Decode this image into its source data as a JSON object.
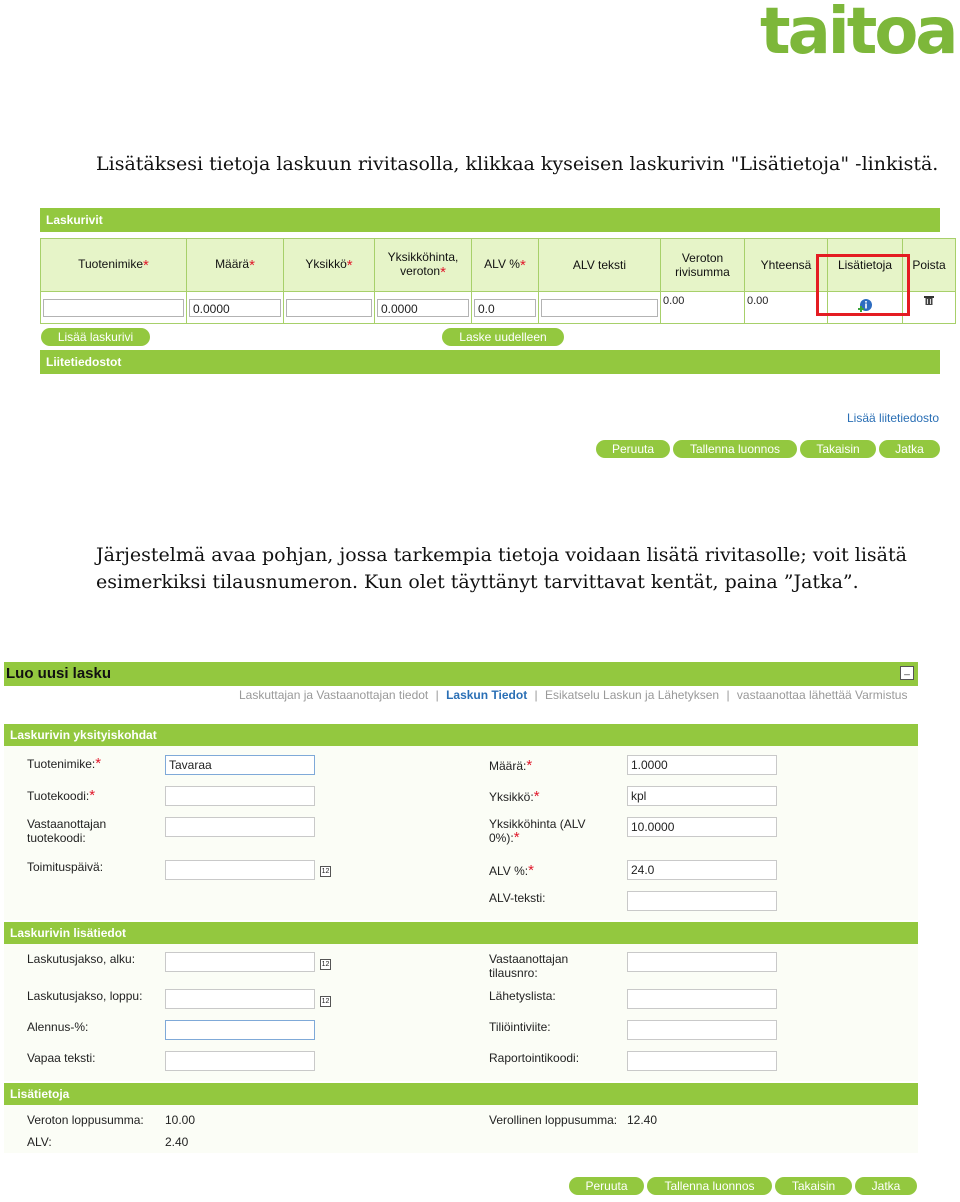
{
  "logo": {
    "text": "taitoa"
  },
  "intro1": "Lisätäksesi tietoja laskuun rivitasolla, klikkaa kyseisen laskurivin \"Lisätietoja\" -linkistä.",
  "intro2_line1": "Järjestelmä avaa pohjan, jossa tarkempia tietoja voidaan lisätä rivitasolle; voit lisätä",
  "intro2_line2": "esimerkiksi tilausnumeron. Kun olet täyttänyt tarvittavat kentät, paina ”Jatka”.",
  "top": {
    "section_laskurivit": "Laskurivit",
    "columns": {
      "tuotenimike": "Tuotenimike",
      "maara": "Määrä",
      "yksikko": "Yksikkö",
      "yksikkohinta_1": "Yksikköhinta,",
      "yksikkohinta_2": "veroton",
      "alv": "ALV %",
      "alv_teksti": "ALV teksti",
      "veroton_1": "Veroton",
      "veroton_2": "rivisumma",
      "yhteensa": "Yhteensä",
      "lisatietoja": "Lisätietoja",
      "poista": "Poista"
    },
    "row": {
      "tuotenimike": "",
      "maara": "0.0000",
      "yksikko": "",
      "yksikkohinta": "0.0000",
      "alv": "0.0",
      "alv_teksti": "",
      "veroton": "0.00",
      "yhteensa": "0.00"
    },
    "add_row_button": "Lisää laskurivi",
    "recalc_button": "Laske uudelleen",
    "section_liitetiedostot": "Liitetiedostot",
    "add_attachment_link": "Lisää liitetiedosto",
    "buttons": {
      "cancel": "Peruuta",
      "save_draft": "Tallenna luonnos",
      "back": "Takaisin",
      "next": "Jatka"
    }
  },
  "form": {
    "title": "Luo uusi lasku",
    "minimize": "_",
    "breadcrumb": {
      "step1": "Laskuttajan ja Vastaanottajan tiedot",
      "step2": "Laskun Tiedot",
      "step3": "Esikatselu Laskun ja Lähetyksen",
      "step4": "vastaanottaa lähettää Varmistus",
      "sep": "|"
    },
    "section1": "Laskurivin yksityiskohdat",
    "s1": {
      "tuotenimike_label": "Tuotenimike:",
      "tuotenimike_value": "Tavaraa",
      "tuotekoodi_label": "Tuotekoodi:",
      "vastaanottajan_1": "Vastaanottajan",
      "vastaanottajan_2": "tuotekoodi:",
      "toimituspaiva_label": "Toimituspäivä:",
      "maara_label": "Määrä:",
      "maara_value": "1.0000",
      "yksikko_label": "Yksikkö:",
      "yksikko_value": "kpl",
      "yksikkohinta_1": "Yksikköhinta (ALV",
      "yksikkohinta_2": "0%):",
      "yksikkohinta_value": "10.0000",
      "alv_label": "ALV %:",
      "alv_value": "24.0",
      "alvteksti_label": "ALV-teksti:"
    },
    "section2": "Laskurivin lisätiedot",
    "s2": {
      "jakso_alku": "Laskutusjakso, alku:",
      "jakso_loppu": "Laskutusjakso, loppu:",
      "alennus": "Alennus-%:",
      "vapaa": "Vapaa teksti:",
      "tilausnro_1": "Vastaanottajan",
      "tilausnro_2": "tilausnro:",
      "lahetyslista": "Lähetyslista:",
      "tiliointiviite": "Tiliöintiviite:",
      "raportointikoodi": "Raportointikoodi:"
    },
    "section3": "Lisätietoja",
    "s3": {
      "veroton_label": "Veroton loppusumma:",
      "veroton_value": "10.00",
      "alv_label": "ALV:",
      "alv_value": "2.40",
      "verollinen_label": "Verollinen loppusumma:",
      "verollinen_value": "12.40"
    },
    "buttons": {
      "cancel": "Peruuta",
      "save_draft": "Tallenna luonnos",
      "back": "Takaisin",
      "next": "Jatka"
    }
  },
  "calendar_glyph": "12",
  "required_mark": "*"
}
